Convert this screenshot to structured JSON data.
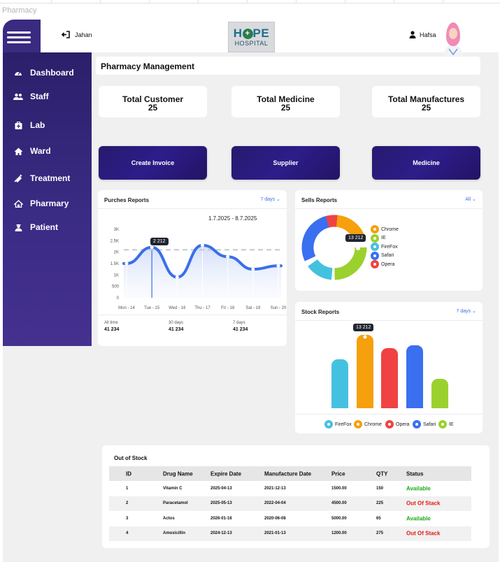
{
  "window": {
    "label": "Pharmacy"
  },
  "topbar": {
    "logout_user": "Jahan",
    "logo_main": "HOPE",
    "logo_sub": "HOSPITAL",
    "current_user": "Hafsa"
  },
  "sidebar": {
    "items": [
      {
        "label": "Dashboard",
        "icon": "gauge-icon"
      },
      {
        "label": "Staff",
        "icon": "users-icon"
      },
      {
        "label": "Lab",
        "icon": "medkit-icon"
      },
      {
        "label": "Ward",
        "icon": "home-icon"
      },
      {
        "label": "Treatment",
        "icon": "syringe-icon"
      },
      {
        "label": "Pharmary",
        "icon": "house-outline-icon"
      },
      {
        "label": "Patient",
        "icon": "user-nurse-icon"
      }
    ]
  },
  "main": {
    "title": "Pharmacy Management",
    "stats": [
      {
        "title": "Total Customer",
        "value": "25"
      },
      {
        "title": "Total Medicine",
        "value": "25"
      },
      {
        "title": "Total Manufactures",
        "value": "25"
      }
    ],
    "actions": [
      "Create Invoice",
      "Supplier",
      "Medicine"
    ]
  },
  "purchase_report": {
    "title": "Purches Reports",
    "range_select": "7 days",
    "date_range": "1.7.2025 - 8.7.2025",
    "tooltip": "2 212",
    "footer": [
      {
        "label": "All time",
        "value": "41 234"
      },
      {
        "label": "30 days",
        "value": "41 234"
      },
      {
        "label": "7 days",
        "value": "41 234"
      }
    ]
  },
  "sells_report": {
    "title": "Sells Reports",
    "range_select": "All",
    "tooltip": "13 212"
  },
  "stock_report": {
    "title": "Stock Reports",
    "range_select": "7 days",
    "tooltip": "13 212"
  },
  "colors": {
    "chrome": "#f5a00c",
    "ie": "#9bd12e",
    "firefox": "#45c1e0",
    "safari": "#3a6ff0",
    "opera": "#f04242",
    "line": "#3b6fe8",
    "sidebar": "#3a2a80"
  },
  "chart_data": [
    {
      "type": "line",
      "title": "Purches Reports",
      "categories": [
        "Mon - 14",
        "Tue - 15",
        "Wed - 16",
        "Thu - 17",
        "Fri - 18",
        "Sat - 19",
        "Sun - 20"
      ],
      "y_ticks": [
        "0",
        "500",
        "1K",
        "1.5K",
        "2K",
        "2.5K",
        "3K"
      ],
      "ylim": [
        0,
        3000
      ],
      "series": [
        {
          "values": [
            1500,
            2212,
            900,
            2300,
            1800,
            1250,
            1400
          ]
        }
      ],
      "reference_line": 2100,
      "grid": false
    },
    {
      "type": "pie",
      "title": "Sells Reports",
      "labels": [
        "Chrome",
        "IE",
        "FireFox",
        "Safari",
        "Opera"
      ],
      "values": [
        22,
        26,
        15,
        30,
        7
      ],
      "colors": [
        "#f5a00c",
        "#9bd12e",
        "#45c1e0",
        "#3a6ff0",
        "#f04242"
      ],
      "legend": "right"
    },
    {
      "type": "bar",
      "title": "Stock Reports",
      "categories": [
        "FireFox",
        "Chrome",
        "Opera",
        "Safari",
        "IE"
      ],
      "values": [
        70,
        105,
        86,
        90,
        42
      ],
      "colors": [
        "#45c1e0",
        "#f5a00c",
        "#f04242",
        "#3a6ff0",
        "#9bd12e"
      ],
      "legend": "bottom"
    }
  ],
  "out_of_stock": {
    "title": "Out of Stock",
    "columns": [
      "ID",
      "Drug Name",
      "Expire Date",
      "Manufacture Date",
      "Price",
      "QTY",
      "Status"
    ],
    "rows": [
      [
        "1",
        "Vitamin C",
        "2025-04-13",
        "2021-12-13",
        "1500.00",
        "150",
        "Available"
      ],
      [
        "2",
        "Paracetamol",
        "2025-05-13",
        "2022-04-04",
        "4500.00",
        "225",
        "Out Of Stack"
      ],
      [
        "3",
        "Actos",
        "2026-01-16",
        "2020-06-08",
        "5000.00",
        "65",
        "Available"
      ],
      [
        "4",
        "Amoxicillin",
        "2024-12-13",
        "2021-01-13",
        "1200.00",
        "275",
        "Out Of Stack"
      ]
    ]
  }
}
